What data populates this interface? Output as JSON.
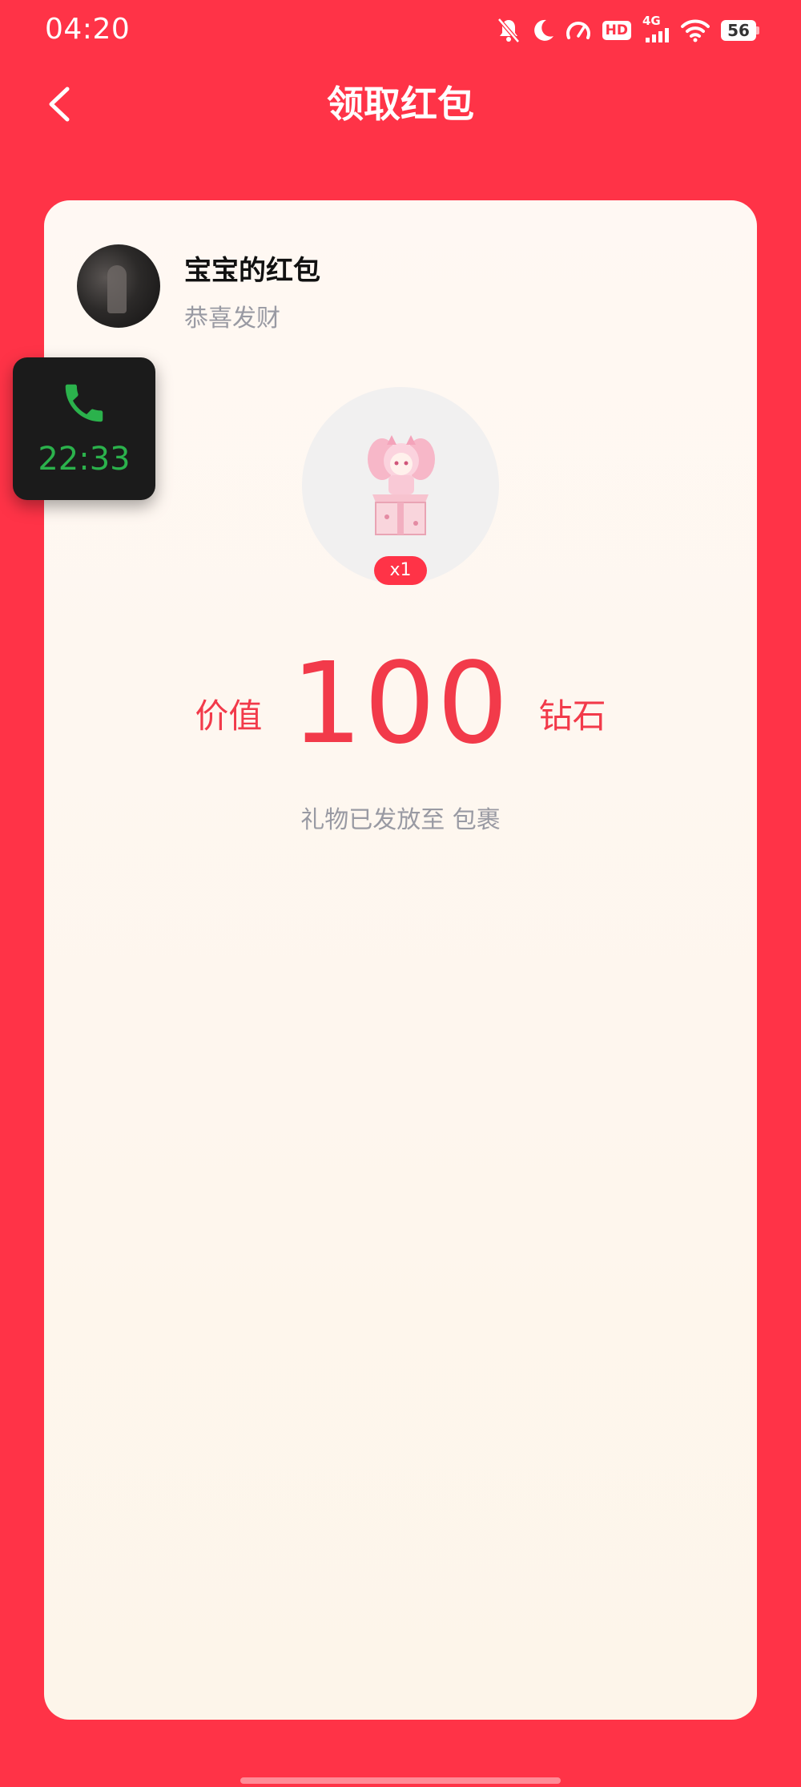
{
  "status_bar": {
    "time": "04:20",
    "hd_label": "HD",
    "network_label": "4G",
    "battery_level": "56",
    "icons": [
      "mute-bell-icon",
      "moon-icon",
      "speedometer-icon",
      "hd-icon",
      "signal-4g-icon",
      "wifi-icon",
      "battery-icon"
    ]
  },
  "nav": {
    "back_icon": "chevron-left-icon",
    "title": "领取红包"
  },
  "red_packet": {
    "sender_name": "宝宝的红包",
    "wish": "恭喜发财",
    "gift_quantity": "x1",
    "value_prefix": "价值",
    "value_amount": "100",
    "value_unit": "钻石",
    "delivery_note": "礼物已发放至 包裹"
  },
  "call_widget": {
    "icon": "phone-icon",
    "duration": "22:33"
  },
  "colors": {
    "background": "#FF3347",
    "accent": "#F23A4A",
    "card": "#FFF8F3",
    "call_green": "#2BB24C"
  }
}
